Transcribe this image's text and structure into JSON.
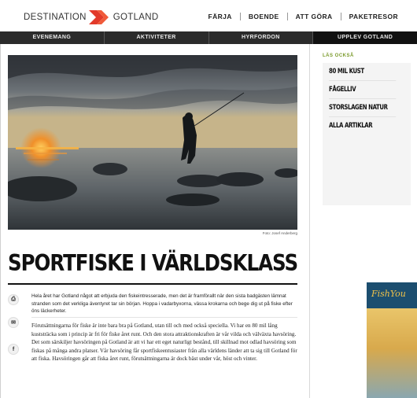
{
  "header": {
    "logo": {
      "left": "DESTINATION",
      "right": "GOTLAND",
      "chevron_color": "#e23a2a"
    },
    "topnav": [
      "FÄRJA",
      "BOENDE",
      "ATT GÖRA",
      "PAKETRESOR"
    ]
  },
  "subnav": [
    {
      "label": "EVENEMANG",
      "active": false
    },
    {
      "label": "AKTIVITETER",
      "active": false
    },
    {
      "label": "HYRFORDON",
      "active": false
    },
    {
      "label": "UPPLEV GOTLAND",
      "active": true
    }
  ],
  "article": {
    "photo_caption": "Foto: Josef Anderberg",
    "title": "SPORTFISKE I VÄRLDSKLASS",
    "lead": "Hela året har Gotland något att erbjuda den fiskeintresserade, men det är framförallt när den sista badgästen lämnat stranden som det verkliga äventyret tar sin början. Hoppa i vadarbyxorna, vässa krokarna och bege dig ut på fiske efter öns läckerheter.",
    "body": "Förutsättningarna för fiske är inte bara bra på Gotland, utan till och med också speciella. Vi har en 80 mil lång kuststräcka som i princip är fri för fiske året runt. Och den stora attraktionskraften är vår vilda och välväxta havsöring. Det som särskiljer havsöringen på Gotland är att vi har ett eget naturligt bestånd, till skillnad mot odlad havsöring som fiskas på många andra platser. Vår havsöring får sportfiskeentusiaster från alla världens länder att ta sig till Gotland för att fiska. Havsöringen går att fiska året runt, förutsättningarna är dock bäst under vår, höst och vinter."
  },
  "share": [
    {
      "icon": "print-icon",
      "glyph": "⎙"
    },
    {
      "icon": "mail-icon",
      "glyph": "✉"
    },
    {
      "icon": "facebook-icon",
      "glyph": "f"
    }
  ],
  "sidebar": {
    "heading": "LÄS OCKSÅ",
    "heading_color": "#7a9a2a",
    "items": [
      "80 MIL KUST",
      "FÅGELLIV",
      "STORSLAGEN NATUR",
      "ALLA ARTIKLAR"
    ]
  },
  "ad": {
    "logo_text": "FishYou"
  }
}
